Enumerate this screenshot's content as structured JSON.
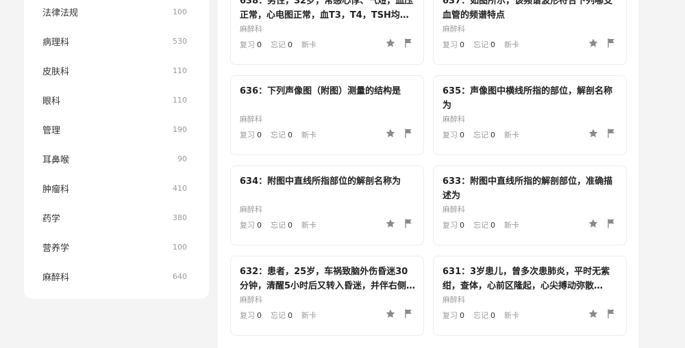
{
  "sidebar": {
    "items": [
      {
        "label": "法律法规",
        "count": "100"
      },
      {
        "label": "病理科",
        "count": "530"
      },
      {
        "label": "皮肤科",
        "count": "110"
      },
      {
        "label": "眼科",
        "count": "110"
      },
      {
        "label": "管理",
        "count": "190"
      },
      {
        "label": "耳鼻喉",
        "count": "90"
      },
      {
        "label": "肿瘤科",
        "count": "410"
      },
      {
        "label": "药学",
        "count": "380"
      },
      {
        "label": "营养学",
        "count": "100"
      },
      {
        "label": "麻醉科",
        "count": "640"
      }
    ]
  },
  "cards": [
    {
      "title": "638：男性，32岁，常感心悸、气短，血压正常，心电图正常，血T3，T4，TSH均…",
      "subject": "麻醉科",
      "review_label": "复习",
      "review": "0",
      "forget_label": "忘记",
      "forget": "0",
      "new_label": "新卡"
    },
    {
      "title": "637：如图所示，该频谱波形符合下列哪支血管的频谱特点",
      "subject": "麻醉科",
      "review_label": "复习",
      "review": "0",
      "forget_label": "忘记",
      "forget": "0",
      "new_label": "新卡"
    },
    {
      "title": "636：下列声像图（附图）测量的结构是",
      "subject": "麻醉科",
      "review_label": "复习",
      "review": "0",
      "forget_label": "忘记",
      "forget": "0",
      "new_label": "新卡"
    },
    {
      "title": "635：声像图中横线所指的部位，解剖名称为",
      "subject": "麻醉科",
      "review_label": "复习",
      "review": "0",
      "forget_label": "忘记",
      "forget": "0",
      "new_label": "新卡"
    },
    {
      "title": "634：附图中直线所指部位的解剖名称为",
      "subject": "麻醉科",
      "review_label": "复习",
      "review": "0",
      "forget_label": "忘记",
      "forget": "0",
      "new_label": "新卡"
    },
    {
      "title": "633：附图中直线所指的解剖部位，准确描述为",
      "subject": "麻醉科",
      "review_label": "复习",
      "review": "0",
      "forget_label": "忘记",
      "forget": "0",
      "new_label": "新卡"
    },
    {
      "title": "632：患者，25岁，车祸致脑外伤昏迷30分钟，清醒5小时后又转入昏迷，并伴右侧…",
      "subject": "麻醉科",
      "review_label": "复习",
      "review": "0",
      "forget_label": "忘记",
      "forget": "0",
      "new_label": "新卡"
    },
    {
      "title": "631：3岁患儿，曾多次患肺炎，平时无紫绀，查体，心前区隆起，心尖搏动弥散…",
      "subject": "麻醉科",
      "review_label": "复习",
      "review": "0",
      "forget_label": "忘记",
      "forget": "0",
      "new_label": "新卡"
    }
  ],
  "icons": {
    "star": "star-icon",
    "flag": "flag-icon"
  },
  "colors": {
    "icon": "#8a8a8a",
    "muted": "#999999",
    "title": "#222222"
  }
}
